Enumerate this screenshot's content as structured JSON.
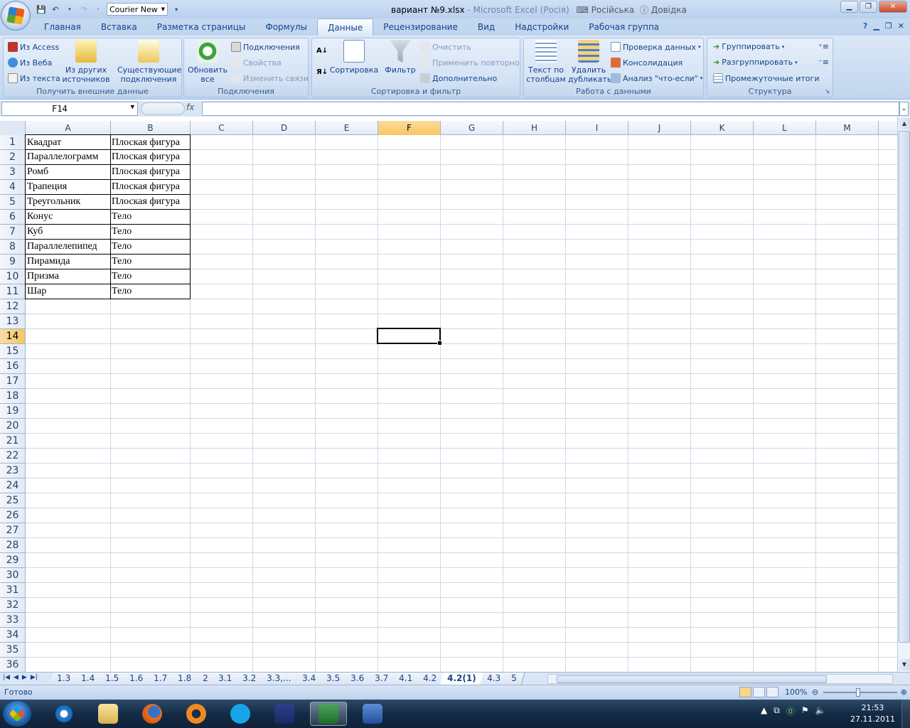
{
  "titlebar": {
    "font_name": "Courier New",
    "title_main": "вариант №9.xlsx",
    "title_faded": "- Microsoft Excel (Росія)",
    "lang": "Російська",
    "help": "Довідка"
  },
  "tabs": [
    "Главная",
    "Вставка",
    "Разметка страницы",
    "Формулы",
    "Данные",
    "Рецензирование",
    "Вид",
    "Надстройки",
    "Рабочая группа"
  ],
  "ribbon": {
    "external": {
      "from_access": "Из Access",
      "from_web": "Из Веба",
      "from_text": "Из текста",
      "other_sources": "Из других источников",
      "existing": "Существующие подключения",
      "label": "Получить внешние данные"
    },
    "connections": {
      "refresh_all": "Обновить все",
      "connections": "Подключения",
      "properties": "Свойства",
      "edit_links": "Изменить связи",
      "label": "Подключения"
    },
    "sortfilter": {
      "sort": "Сортировка",
      "filter": "Фильтр",
      "clear": "Очистить",
      "reapply": "Применить повторно",
      "advanced": "Дополнительно",
      "label": "Сортировка и фильтр"
    },
    "datatools": {
      "text_to_columns": "Текст по столбцам",
      "remove_dup": "Удалить дубликаты",
      "validation": "Проверка данных",
      "consolidate": "Консолидация",
      "whatif": "Анализ \"что-если\"",
      "label": "Работа с данными"
    },
    "outline": {
      "group": "Группировать",
      "ungroup": "Разгруппировать",
      "subtotal": "Промежуточные итоги",
      "label": "Структура"
    }
  },
  "formula_bar": {
    "name_box": "F14",
    "fx": "fx",
    "formula": ""
  },
  "columns": [
    "A",
    "B",
    "C",
    "D",
    "E",
    "F",
    "G",
    "H",
    "I",
    "J",
    "K",
    "L",
    "M"
  ],
  "selected_column": "F",
  "selected_row": 14,
  "rows": [
    "1",
    "2",
    "3",
    "4",
    "5",
    "6",
    "7",
    "8",
    "9",
    "10",
    "11",
    "12",
    "13",
    "14",
    "15",
    "16",
    "17",
    "18",
    "19",
    "20",
    "21",
    "22",
    "23",
    "24",
    "25",
    "26",
    "27",
    "28",
    "29",
    "30",
    "31",
    "32",
    "33",
    "34",
    "35",
    "36"
  ],
  "cells": [
    [
      "Квадрат",
      "Плоская фигура"
    ],
    [
      "Параллелограмм",
      "Плоская фигура"
    ],
    [
      "Ромб",
      "Плоская фигура"
    ],
    [
      "Трапеция",
      "Плоская фигура"
    ],
    [
      "Треугольник",
      "Плоская фигура"
    ],
    [
      "Конус",
      "Тело"
    ],
    [
      "Куб",
      "Тело"
    ],
    [
      "Параллелепипед",
      "Тело"
    ],
    [
      "Пирамида",
      "Тело"
    ],
    [
      "Призма",
      "Тело"
    ],
    [
      "Шар",
      "Тело"
    ]
  ],
  "sheets": [
    "1.3",
    "1.4",
    "1.5",
    "1.6",
    "1.7",
    "1.8",
    "2",
    "3.1",
    "3.2",
    "3.3,...",
    "3.4",
    "3.5",
    "3.6",
    "3.7",
    "4.1",
    "4.2",
    "4.2(1)",
    "4.3",
    "5"
  ],
  "active_sheet": "4.2(1)",
  "status": {
    "ready": "Готово",
    "zoom": "100%"
  },
  "taskbar": {
    "time": "21:53",
    "date": "27.11.2011"
  }
}
